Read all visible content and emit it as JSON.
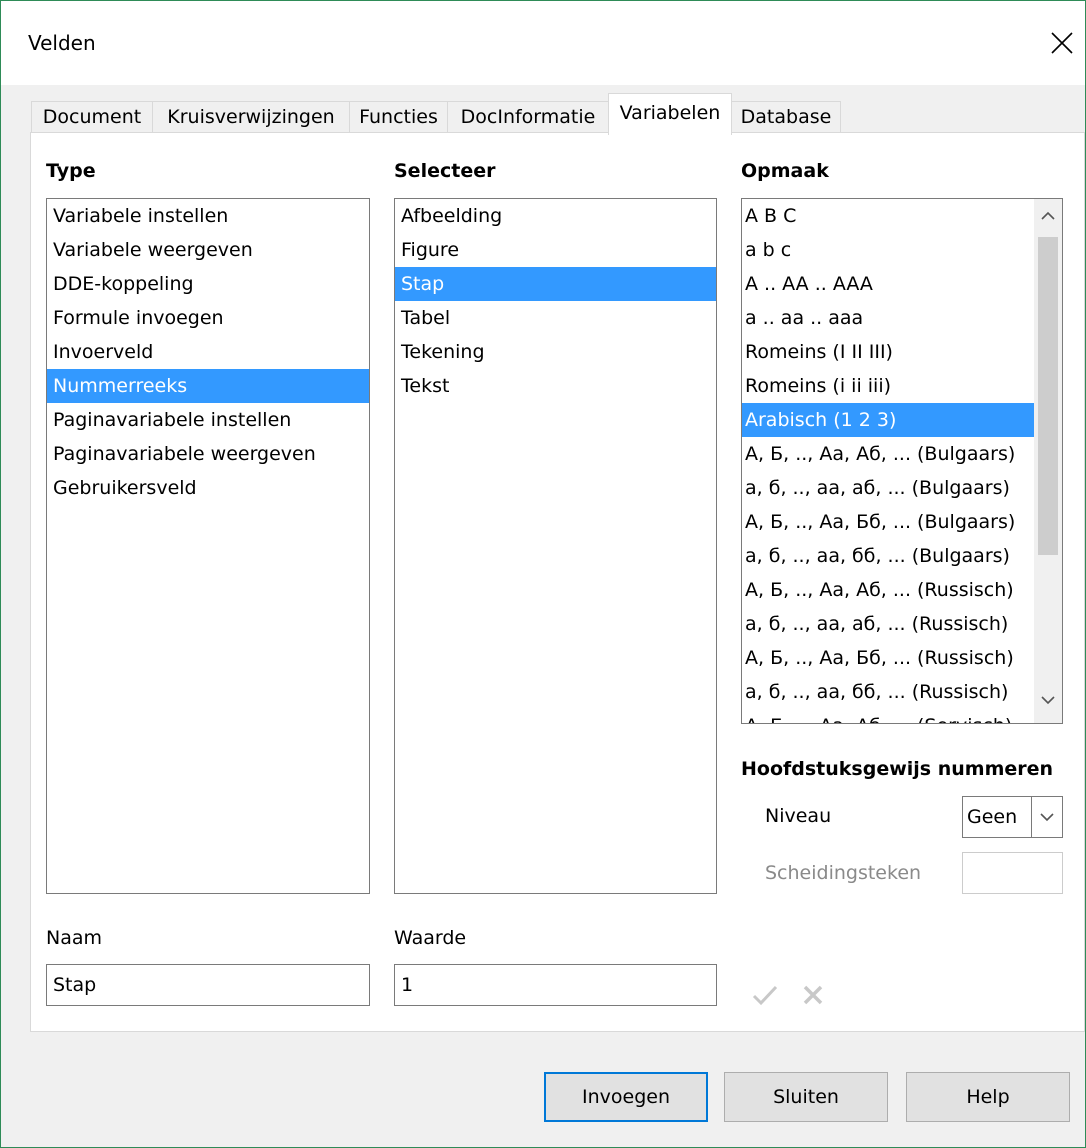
{
  "window": {
    "title": "Velden"
  },
  "tabs": [
    {
      "label": "Document"
    },
    {
      "label": "Kruisverwijzingen"
    },
    {
      "label": "Functies"
    },
    {
      "label": "DocInformatie"
    },
    {
      "label": "Variabelen"
    },
    {
      "label": "Database"
    }
  ],
  "active_tab": "Variabelen",
  "type": {
    "heading": "Type",
    "items": [
      "Variabele instellen",
      "Variabele weergeven",
      "DDE-koppeling",
      "Formule invoegen",
      "Invoerveld",
      "Nummerreeks",
      "Paginavariabele instellen",
      "Paginavariabele weergeven",
      "Gebruikersveld"
    ],
    "selected": "Nummerreeks"
  },
  "select": {
    "heading": "Selecteer",
    "items": [
      "Afbeelding",
      "Figure",
      "Stap",
      "Tabel",
      "Tekening",
      "Tekst"
    ],
    "selected": "Stap"
  },
  "format": {
    "heading": "Opmaak",
    "items": [
      "A B C",
      "a b c",
      "A .. AA .. AAA",
      "a .. aa .. aaa",
      "Romeins (I II III)",
      "Romeins (i ii iii)",
      "Arabisch (1 2 3)",
      "А, Б, .., Аа, Аб, ... (Bulgaars)",
      "а, б, .., аа, аб, ... (Bulgaars)",
      "А, Б, .., Аа, Бб, ... (Bulgaars)",
      "а, б, .., аа, бб, ... (Bulgaars)",
      "А, Б, .., Аа, Аб, ... (Russisch)",
      "а, б, .., аа, аб, ... (Russisch)",
      "А, Б, .., Аа, Бб, ... (Russisch)",
      "а, б, .., аа, бб, ... (Russisch)",
      "А, Б, .., Аа, Аб, ... (Servisch)"
    ],
    "selected": "Arabisch (1 2 3)"
  },
  "chapter": {
    "heading": "Hoofdstuksgewijs nummeren",
    "level_label": "Niveau",
    "level_value": "Geen",
    "separator_label": "Scheidingsteken",
    "separator_value": ""
  },
  "name": {
    "label": "Naam",
    "value": "Stap"
  },
  "value": {
    "label": "Waarde",
    "value": "1"
  },
  "buttons": {
    "insert": "Invoegen",
    "close": "Sluiten",
    "help": "Help"
  },
  "colors": {
    "selection": "#3399ff",
    "default_button_border": "#0078d7",
    "window_border": "#2e8b57"
  }
}
